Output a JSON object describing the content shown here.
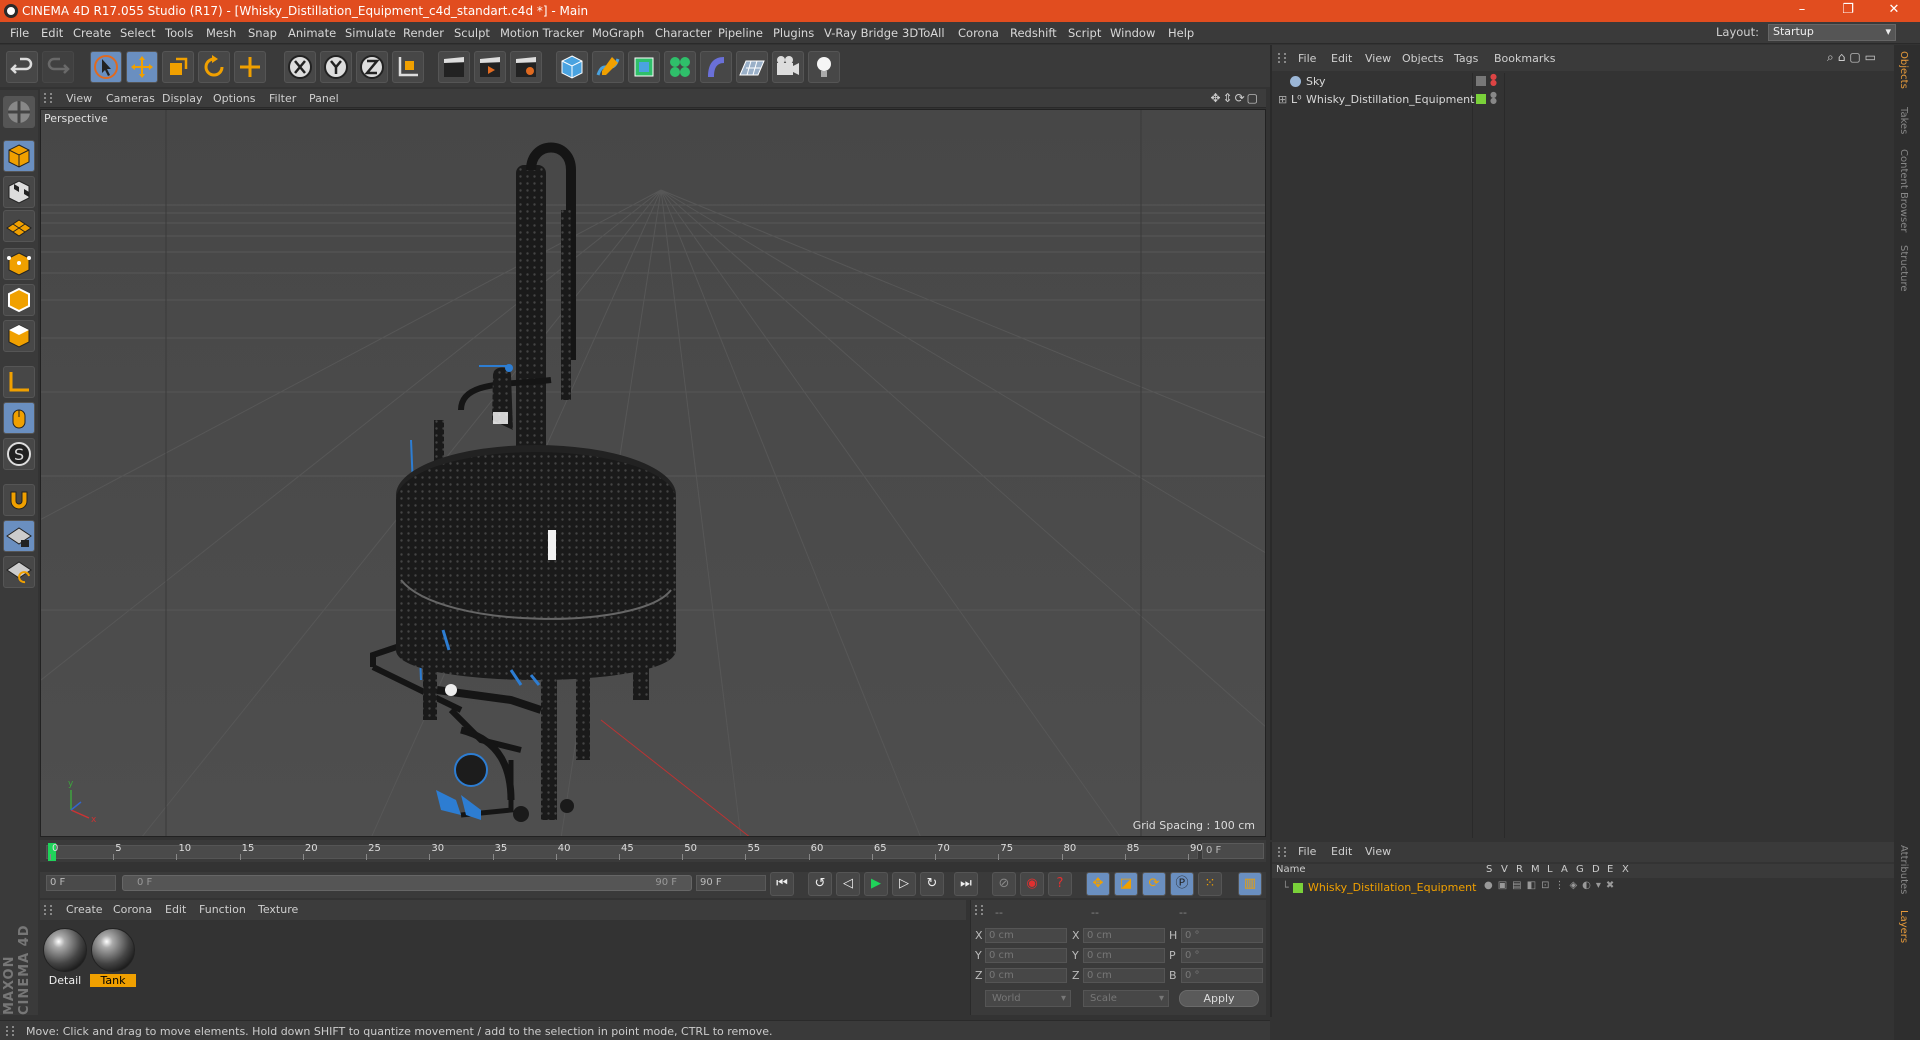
{
  "window": {
    "title": "CINEMA 4D R17.055 Studio (R17) - [Whisky_Distillation_Equipment_c4d_standart.c4d *] - Main",
    "minimize": "–",
    "restore": "❐",
    "close": "✕"
  },
  "menu": [
    "File",
    "Edit",
    "Create",
    "Select",
    "Tools",
    "Mesh",
    "Snap",
    "Animate",
    "Simulate",
    "Render",
    "Sculpt",
    "Motion Tracker",
    "MoGraph",
    "Character",
    "Pipeline",
    "Plugins",
    "V-Ray Bridge",
    "3DToAll",
    "Corona",
    "Redshift",
    "Script",
    "Window",
    "Help"
  ],
  "layout": {
    "label": "Layout:",
    "value": "Startup"
  },
  "viewport": {
    "menu": [
      "View",
      "Cameras",
      "Display",
      "Options",
      "Filter",
      "Panel"
    ],
    "label": "Perspective",
    "grid_spacing": "Grid Spacing : 100 cm"
  },
  "timeline": {
    "ticks": [
      "0",
      "5",
      "10",
      "15",
      "20",
      "25",
      "30",
      "35",
      "40",
      "45",
      "50",
      "55",
      "60",
      "65",
      "70",
      "75",
      "80",
      "85",
      "90"
    ],
    "current_frame": "0 F",
    "start": "0 F",
    "range_start": "0 F",
    "range_end": "90 F",
    "end": "90 F"
  },
  "material_manager": {
    "menu": [
      "Create",
      "Corona",
      "Edit",
      "Function",
      "Texture"
    ],
    "materials": [
      {
        "name": "Detail",
        "selected": false
      },
      {
        "name": "Tank",
        "selected": true
      }
    ]
  },
  "coordinates": {
    "header": [
      "--",
      "--",
      "--"
    ],
    "rows": [
      {
        "a": "X",
        "av": "0 cm",
        "b": "X",
        "bv": "0 cm",
        "c": "H",
        "cv": "0 °"
      },
      {
        "a": "Y",
        "av": "0 cm",
        "b": "Y",
        "bv": "0 cm",
        "c": "P",
        "cv": "0 °"
      },
      {
        "a": "Z",
        "av": "0 cm",
        "b": "Z",
        "bv": "0 cm",
        "c": "B",
        "cv": "0 °"
      }
    ],
    "mode": "World",
    "transform": "Scale",
    "apply": "Apply"
  },
  "status": "Move: Click and drag to move elements. Hold down SHIFT to quantize movement / add to the selection in point mode, CTRL to remove.",
  "object_manager": {
    "menu": [
      "File",
      "Edit",
      "View",
      "Objects",
      "Tags",
      "Bookmarks"
    ],
    "objects": [
      {
        "name": "Sky"
      },
      {
        "name": "Whisky_Distillation_Equipment"
      }
    ]
  },
  "layer_manager": {
    "menu": [
      "File",
      "Edit",
      "View"
    ],
    "columns": [
      "Name",
      "S",
      "V",
      "R",
      "M",
      "L",
      "A",
      "G",
      "D",
      "E",
      "X"
    ],
    "layers": [
      {
        "name": "Whisky_Distillation_Equipment",
        "color": "#7ad13a"
      }
    ]
  },
  "right_tabs": [
    "Objects",
    "Takes",
    "Content Browser",
    "Structure",
    "Attributes",
    "Layers"
  ],
  "brand": "MAXON CINEMA 4D",
  "colors": {
    "titlebar": "#e14d1f",
    "accent": "#f0a000",
    "active_tool": "#6a8fc0"
  }
}
